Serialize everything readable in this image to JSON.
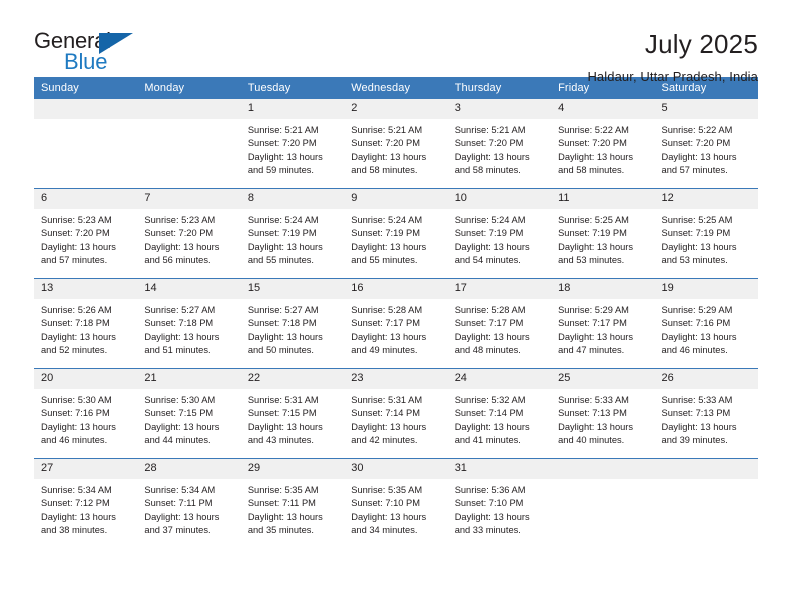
{
  "brand": {
    "name_top": "General",
    "name_bottom": "Blue",
    "triangle_color": "#1565a8",
    "blue_text_color": "#1f7ac1"
  },
  "header": {
    "title": "July 2025",
    "location": "Haldaur, Uttar Pradesh, India"
  },
  "theme": {
    "header_blue": "#3b79b8",
    "daynum_band": "#f0f0f0",
    "text": "#231f20"
  },
  "weekdays": [
    "Sunday",
    "Monday",
    "Tuesday",
    "Wednesday",
    "Thursday",
    "Friday",
    "Saturday"
  ],
  "weeks": [
    [
      {
        "day": "",
        "blank": true
      },
      {
        "day": "",
        "blank": true
      },
      {
        "day": "1",
        "sunrise": "Sunrise: 5:21 AM",
        "sunset": "Sunset: 7:20 PM",
        "daylight": "Daylight: 13 hours and 59 minutes."
      },
      {
        "day": "2",
        "sunrise": "Sunrise: 5:21 AM",
        "sunset": "Sunset: 7:20 PM",
        "daylight": "Daylight: 13 hours and 58 minutes."
      },
      {
        "day": "3",
        "sunrise": "Sunrise: 5:21 AM",
        "sunset": "Sunset: 7:20 PM",
        "daylight": "Daylight: 13 hours and 58 minutes."
      },
      {
        "day": "4",
        "sunrise": "Sunrise: 5:22 AM",
        "sunset": "Sunset: 7:20 PM",
        "daylight": "Daylight: 13 hours and 58 minutes."
      },
      {
        "day": "5",
        "sunrise": "Sunrise: 5:22 AM",
        "sunset": "Sunset: 7:20 PM",
        "daylight": "Daylight: 13 hours and 57 minutes."
      }
    ],
    [
      {
        "day": "6",
        "sunrise": "Sunrise: 5:23 AM",
        "sunset": "Sunset: 7:20 PM",
        "daylight": "Daylight: 13 hours and 57 minutes."
      },
      {
        "day": "7",
        "sunrise": "Sunrise: 5:23 AM",
        "sunset": "Sunset: 7:20 PM",
        "daylight": "Daylight: 13 hours and 56 minutes."
      },
      {
        "day": "8",
        "sunrise": "Sunrise: 5:24 AM",
        "sunset": "Sunset: 7:19 PM",
        "daylight": "Daylight: 13 hours and 55 minutes."
      },
      {
        "day": "9",
        "sunrise": "Sunrise: 5:24 AM",
        "sunset": "Sunset: 7:19 PM",
        "daylight": "Daylight: 13 hours and 55 minutes."
      },
      {
        "day": "10",
        "sunrise": "Sunrise: 5:24 AM",
        "sunset": "Sunset: 7:19 PM",
        "daylight": "Daylight: 13 hours and 54 minutes."
      },
      {
        "day": "11",
        "sunrise": "Sunrise: 5:25 AM",
        "sunset": "Sunset: 7:19 PM",
        "daylight": "Daylight: 13 hours and 53 minutes."
      },
      {
        "day": "12",
        "sunrise": "Sunrise: 5:25 AM",
        "sunset": "Sunset: 7:19 PM",
        "daylight": "Daylight: 13 hours and 53 minutes."
      }
    ],
    [
      {
        "day": "13",
        "sunrise": "Sunrise: 5:26 AM",
        "sunset": "Sunset: 7:18 PM",
        "daylight": "Daylight: 13 hours and 52 minutes."
      },
      {
        "day": "14",
        "sunrise": "Sunrise: 5:27 AM",
        "sunset": "Sunset: 7:18 PM",
        "daylight": "Daylight: 13 hours and 51 minutes."
      },
      {
        "day": "15",
        "sunrise": "Sunrise: 5:27 AM",
        "sunset": "Sunset: 7:18 PM",
        "daylight": "Daylight: 13 hours and 50 minutes."
      },
      {
        "day": "16",
        "sunrise": "Sunrise: 5:28 AM",
        "sunset": "Sunset: 7:17 PM",
        "daylight": "Daylight: 13 hours and 49 minutes."
      },
      {
        "day": "17",
        "sunrise": "Sunrise: 5:28 AM",
        "sunset": "Sunset: 7:17 PM",
        "daylight": "Daylight: 13 hours and 48 minutes."
      },
      {
        "day": "18",
        "sunrise": "Sunrise: 5:29 AM",
        "sunset": "Sunset: 7:17 PM",
        "daylight": "Daylight: 13 hours and 47 minutes."
      },
      {
        "day": "19",
        "sunrise": "Sunrise: 5:29 AM",
        "sunset": "Sunset: 7:16 PM",
        "daylight": "Daylight: 13 hours and 46 minutes."
      }
    ],
    [
      {
        "day": "20",
        "sunrise": "Sunrise: 5:30 AM",
        "sunset": "Sunset: 7:16 PM",
        "daylight": "Daylight: 13 hours and 46 minutes."
      },
      {
        "day": "21",
        "sunrise": "Sunrise: 5:30 AM",
        "sunset": "Sunset: 7:15 PM",
        "daylight": "Daylight: 13 hours and 44 minutes."
      },
      {
        "day": "22",
        "sunrise": "Sunrise: 5:31 AM",
        "sunset": "Sunset: 7:15 PM",
        "daylight": "Daylight: 13 hours and 43 minutes."
      },
      {
        "day": "23",
        "sunrise": "Sunrise: 5:31 AM",
        "sunset": "Sunset: 7:14 PM",
        "daylight": "Daylight: 13 hours and 42 minutes."
      },
      {
        "day": "24",
        "sunrise": "Sunrise: 5:32 AM",
        "sunset": "Sunset: 7:14 PM",
        "daylight": "Daylight: 13 hours and 41 minutes."
      },
      {
        "day": "25",
        "sunrise": "Sunrise: 5:33 AM",
        "sunset": "Sunset: 7:13 PM",
        "daylight": "Daylight: 13 hours and 40 minutes."
      },
      {
        "day": "26",
        "sunrise": "Sunrise: 5:33 AM",
        "sunset": "Sunset: 7:13 PM",
        "daylight": "Daylight: 13 hours and 39 minutes."
      }
    ],
    [
      {
        "day": "27",
        "sunrise": "Sunrise: 5:34 AM",
        "sunset": "Sunset: 7:12 PM",
        "daylight": "Daylight: 13 hours and 38 minutes."
      },
      {
        "day": "28",
        "sunrise": "Sunrise: 5:34 AM",
        "sunset": "Sunset: 7:11 PM",
        "daylight": "Daylight: 13 hours and 37 minutes."
      },
      {
        "day": "29",
        "sunrise": "Sunrise: 5:35 AM",
        "sunset": "Sunset: 7:11 PM",
        "daylight": "Daylight: 13 hours and 35 minutes."
      },
      {
        "day": "30",
        "sunrise": "Sunrise: 5:35 AM",
        "sunset": "Sunset: 7:10 PM",
        "daylight": "Daylight: 13 hours and 34 minutes."
      },
      {
        "day": "31",
        "sunrise": "Sunrise: 5:36 AM",
        "sunset": "Sunset: 7:10 PM",
        "daylight": "Daylight: 13 hours and 33 minutes."
      },
      {
        "day": "",
        "blank": true
      },
      {
        "day": "",
        "blank": true
      }
    ]
  ]
}
